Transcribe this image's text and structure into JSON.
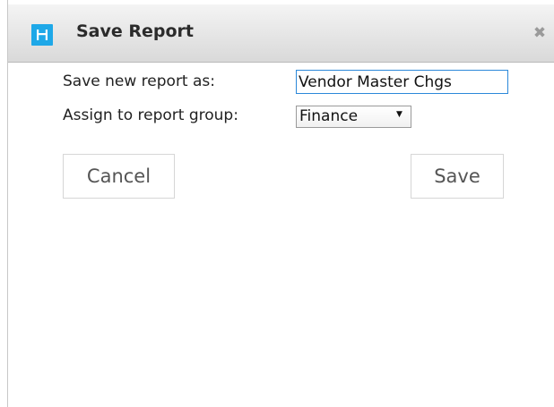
{
  "dialog": {
    "title": "Save Report",
    "app_icon": "app-logo-icon",
    "close_icon": "close-icon",
    "close_glyph": "✖"
  },
  "form": {
    "name_label": "Save new report as:",
    "name_value": "Vendor Master Chgs",
    "group_label": "Assign to report group:",
    "group_selected": "Finance",
    "dropdown_glyph": "▼"
  },
  "buttons": {
    "cancel": "Cancel",
    "save": "Save"
  },
  "colors": {
    "accent": "#1ea8e8",
    "input_focus_border": "#2b88d9"
  }
}
